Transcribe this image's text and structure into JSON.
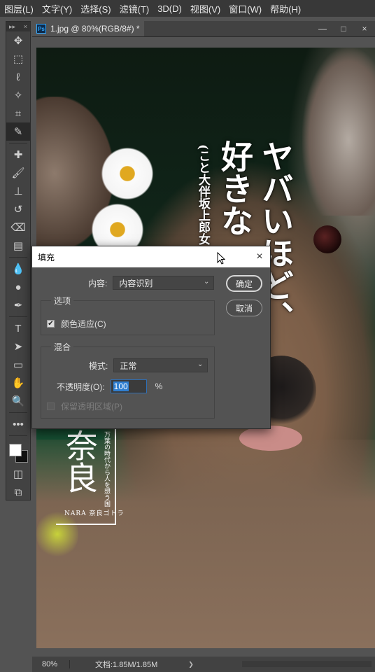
{
  "menu": [
    "图层(L)",
    "文字(Y)",
    "选择(S)",
    "滤镜(T)",
    "3D(D)",
    "视图(V)",
    "窗口(W)",
    "帮助(H)"
  ],
  "toolbar": {
    "collapse_glyph": "▸▸",
    "close_glyph": "×",
    "tools": [
      {
        "name": "move-tool",
        "glyph": "✥"
      },
      {
        "name": "marquee-tool",
        "glyph": "⬚"
      },
      {
        "name": "lasso-tool",
        "glyph": "ℓ"
      },
      {
        "name": "magic-wand-tool",
        "glyph": "✧"
      },
      {
        "name": "crop-tool",
        "glyph": "⌗"
      },
      {
        "name": "eyedropper-tool",
        "glyph": "✎"
      },
      {
        "name": "healing-brush-tool",
        "glyph": "✚"
      },
      {
        "name": "brush-tool",
        "glyph": "🖌"
      },
      {
        "name": "clone-stamp-tool",
        "glyph": "⊥"
      },
      {
        "name": "history-brush-tool",
        "glyph": "↺"
      },
      {
        "name": "eraser-tool",
        "glyph": "⌫"
      },
      {
        "name": "gradient-tool",
        "glyph": "▤"
      },
      {
        "name": "blur-tool",
        "glyph": "💧"
      },
      {
        "name": "dodge-tool",
        "glyph": "●"
      },
      {
        "name": "pen-tool",
        "glyph": "✒"
      },
      {
        "name": "type-tool",
        "glyph": "T"
      },
      {
        "name": "path-selection-tool",
        "glyph": "➤"
      },
      {
        "name": "rectangle-tool",
        "glyph": "▭"
      },
      {
        "name": "hand-tool",
        "glyph": "✋"
      },
      {
        "name": "zoom-tool",
        "glyph": "🔍"
      },
      {
        "name": "more-tools",
        "glyph": "•••"
      }
    ],
    "bottom": [
      {
        "name": "quick-mask-icon",
        "glyph": "◫"
      },
      {
        "name": "screen-mode-icon",
        "glyph": "⧉"
      }
    ]
  },
  "document": {
    "tab_title": "1.jpg @ 80%(RGB/8#) *",
    "ps_badge": "Ps",
    "window_controls": [
      "—",
      "□",
      "×"
    ]
  },
  "artwork": {
    "headline_1": "ヤバいほど、",
    "headline_2": "好きな",
    "author": "(こと大伴坂上郎女",
    "nara_title": "奈良",
    "nara_sub": "万葉の時代から人を想う国",
    "nara_footer": "NARA 奈良ゴトラ"
  },
  "status": {
    "zoom": "80%",
    "doc_info": "文档:1.85M/1.85M",
    "arrow": "❯"
  },
  "fill_dialog": {
    "title": "填充",
    "close": "×",
    "content_label": "内容:",
    "content_value": "内容识别",
    "ok": "确定",
    "cancel": "取消",
    "options_group": "选项",
    "color_adapt_label": "颜色适应(C)",
    "color_adapt_checked": "✔",
    "blend_group": "混合",
    "mode_label": "模式:",
    "mode_value": "正常",
    "opacity_label": "不透明度(O):",
    "opacity_value": "100",
    "opacity_unit": "%",
    "preserve_label": "保留透明区域(P)",
    "chevron": "⌄"
  }
}
